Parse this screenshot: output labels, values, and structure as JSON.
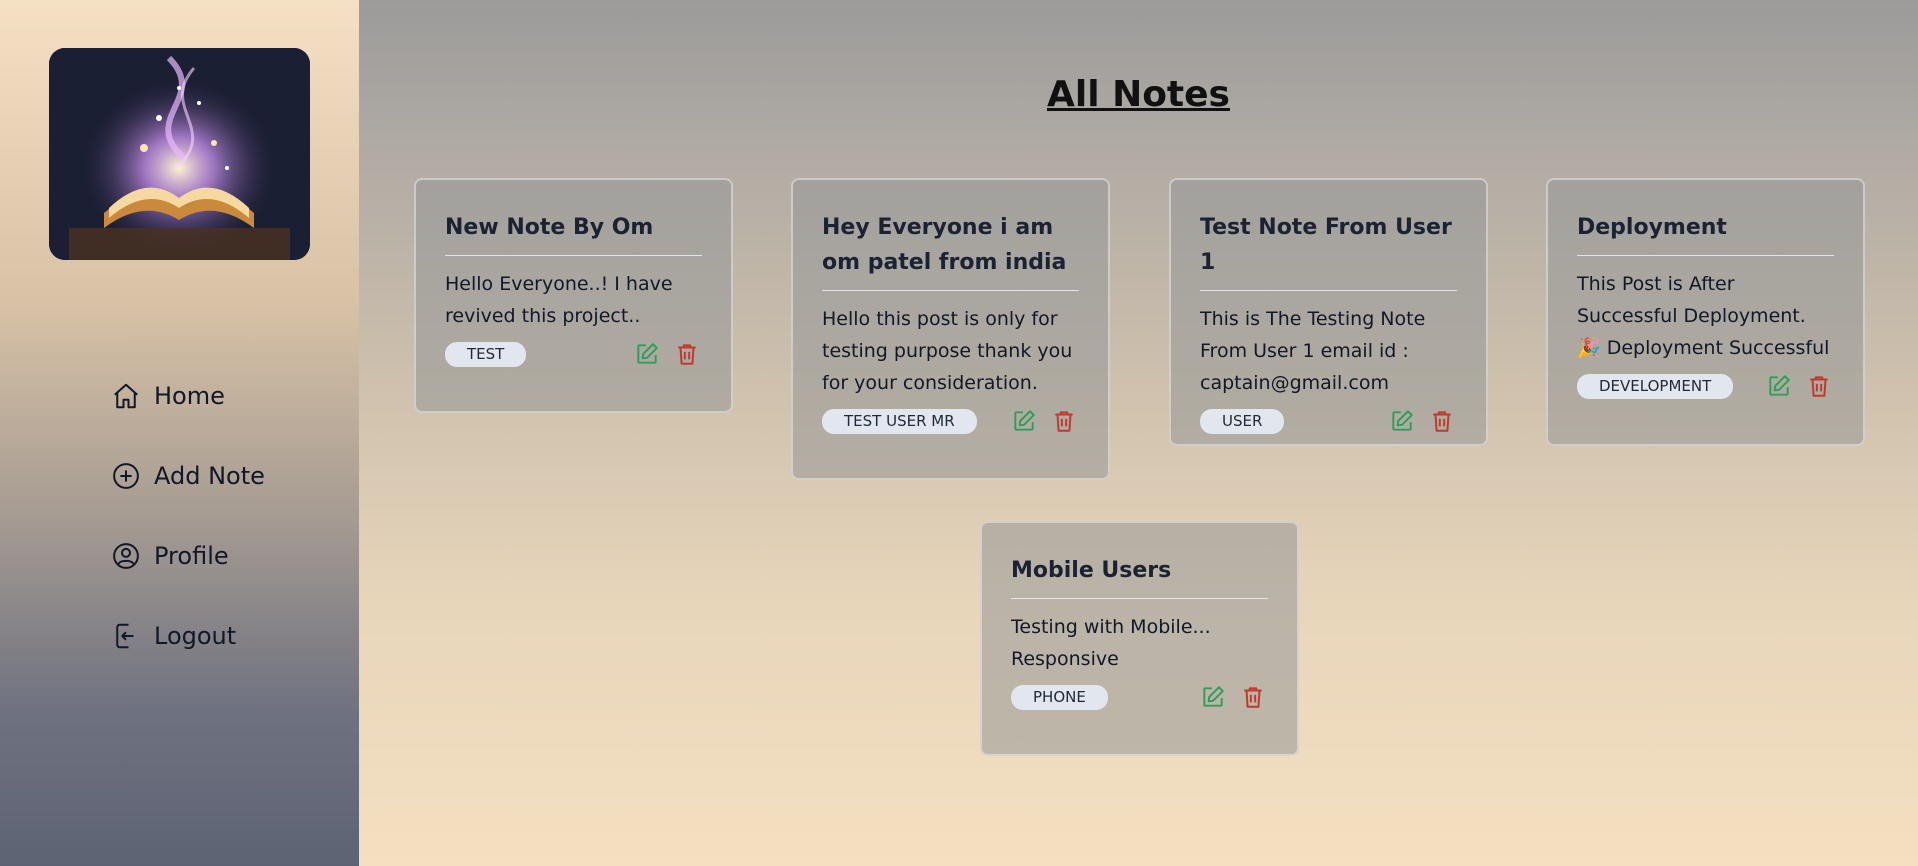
{
  "sidebar": {
    "nav": [
      {
        "label": "Home",
        "icon": "home-icon"
      },
      {
        "label": "Add Note",
        "icon": "plus-circle-icon"
      },
      {
        "label": "Profile",
        "icon": "user-circle-icon"
      },
      {
        "label": "Logout",
        "icon": "logout-icon"
      }
    ]
  },
  "main": {
    "title": "All Notes",
    "notes": [
      {
        "title": "New Note By Om",
        "body": "Hello Everyone..! I have revived this project..",
        "tag": "TEST"
      },
      {
        "title": "Hey Everyone i am om patel from india",
        "body": "Hello this post is only for testing purpose thank you for your consideration.",
        "tag": "TEST USER MR"
      },
      {
        "title": "Test Note From User 1",
        "body": "This is The Testing Note From User 1 email id : captain@gmail.com",
        "tag": "USER"
      },
      {
        "title": "Deployment",
        "body": "This Post is After Successful Deployment. 🎉 Deployment Successful",
        "tag": "DEVELOPMENT"
      },
      {
        "title": "Mobile Users",
        "body": "Testing with Mobile... Responsive",
        "tag": "PHONE"
      }
    ]
  },
  "colors": {
    "edit": "#2f9e5a",
    "delete": "#c0392b",
    "tag_bg": "#e2e7ef"
  }
}
